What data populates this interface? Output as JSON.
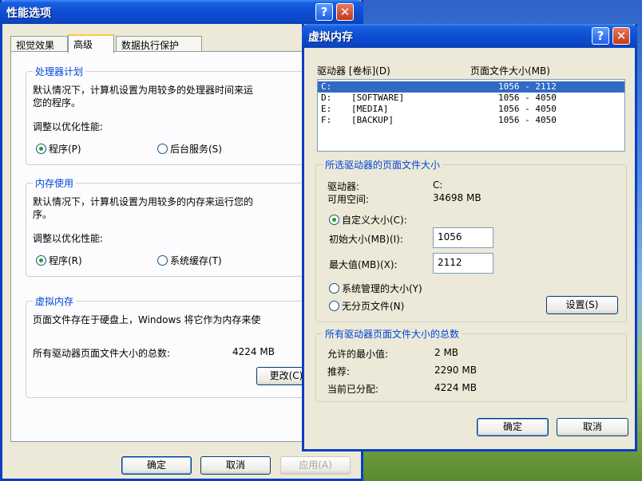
{
  "perf_window": {
    "title": "性能选项",
    "tabs": [
      "视觉效果",
      "高级",
      "数据执行保护"
    ],
    "processor": {
      "group_title": "处理器计划",
      "desc_line1": "默认情况下，计算机设置为用较多的处理器时间来运",
      "desc_line2": "您的程序。",
      "adjust_label": "调整以优化性能:",
      "opt_programs": "程序(P)",
      "opt_background": "后台服务(S)"
    },
    "memory": {
      "group_title": "内存使用",
      "desc_line1": "默认情况下，计算机设置为用较多的内存来运行您的",
      "desc_line2": "序。",
      "adjust_label": "调整以优化性能:",
      "opt_programs": "程序(R)",
      "opt_cache": "系统缓存(T)"
    },
    "virtual": {
      "group_title": "虚拟内存",
      "desc": "页面文件存在于硬盘上，Windows 将它作为内存来使",
      "total_label": "所有驱动器页面文件大小的总数:",
      "total_value": "4224 MB",
      "change_btn": "更改(C)"
    },
    "ok_btn": "确定",
    "cancel_btn": "取消",
    "apply_btn": "应用(A)"
  },
  "vm_dialog": {
    "title": "虚拟内存",
    "col_drive": "驱动器 [卷标](D)",
    "col_size": "页面文件大小(MB)",
    "drives": [
      {
        "drive": "C:",
        "label": "",
        "size": "1056 - 2112"
      },
      {
        "drive": "D:",
        "label": "[SOFTWARE]",
        "size": "1056 - 4050"
      },
      {
        "drive": "E:",
        "label": "[MEDIA]",
        "size": "1056 - 4050"
      },
      {
        "drive": "F:",
        "label": "[BACKUP]",
        "size": "1056 - 4050"
      }
    ],
    "selected": {
      "group_title": "所选驱动器的页面文件大小",
      "drive_label": "驱动器:",
      "drive_value": "C:",
      "free_label": "可用空间:",
      "free_value": "34698 MB",
      "opt_custom": "自定义大小(C):",
      "initial_label": "初始大小(MB)(I):",
      "initial_value": "1056",
      "max_label": "最大值(MB)(X):",
      "max_value": "2112",
      "opt_system": "系统管理的大小(Y)",
      "opt_none": "无分页文件(N)",
      "set_btn": "设置(S)"
    },
    "totals": {
      "group_title": "所有驱动器页面文件大小的总数",
      "min_label": "允许的最小值:",
      "min_value": "2 MB",
      "rec_label": "推荐:",
      "rec_value": "2290 MB",
      "cur_label": "当前已分配:",
      "cur_value": "4224 MB"
    },
    "ok_btn": "确定",
    "cancel_btn": "取消"
  },
  "colors": {
    "titlebar": "#0b47c7",
    "dialog_bg": "#ece9d8",
    "group_title": "#0046d5",
    "selection": "#316ac5"
  }
}
